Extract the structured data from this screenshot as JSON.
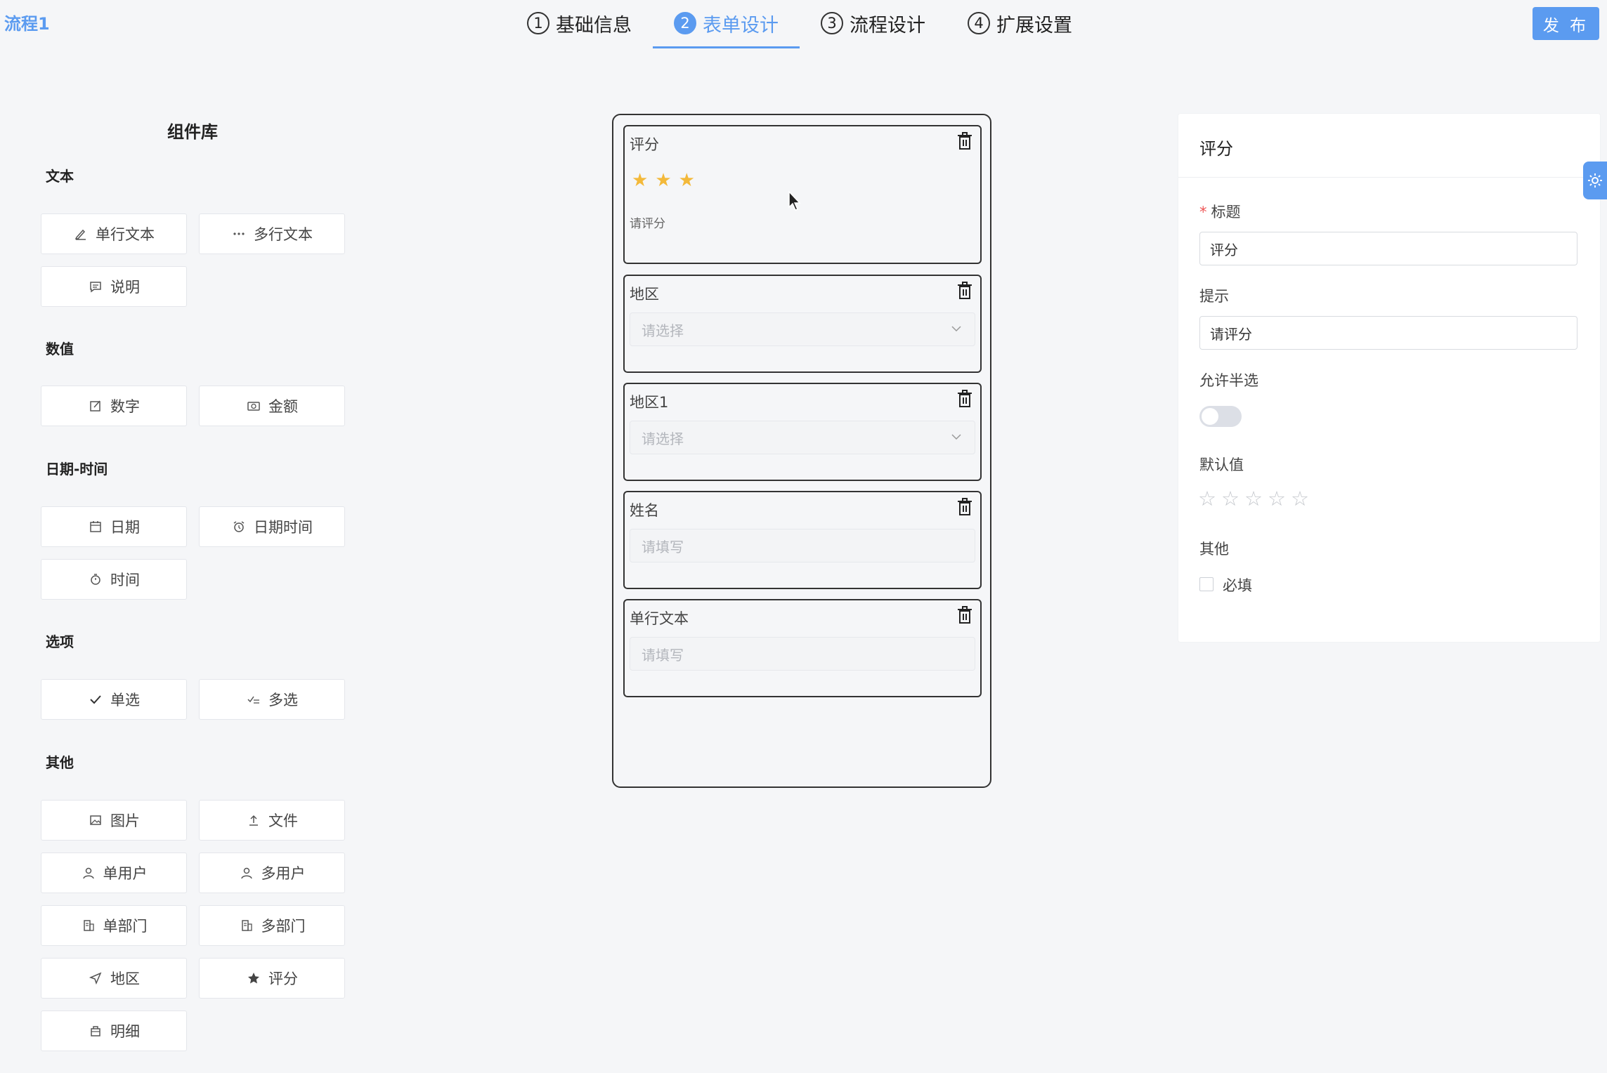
{
  "header": {
    "app_title": "流程1",
    "steps": [
      {
        "num": "1",
        "label": "基础信息"
      },
      {
        "num": "2",
        "label": "表单设计"
      },
      {
        "num": "3",
        "label": "流程设计"
      },
      {
        "num": "4",
        "label": "扩展设置"
      }
    ],
    "active_step": 2,
    "publish_label": "发 布"
  },
  "library": {
    "title": "组件库",
    "sections": [
      {
        "label": "文本",
        "items": [
          {
            "label": "单行文本",
            "icon": "pencil-icon"
          },
          {
            "label": "多行文本",
            "icon": "ellipsis-icon"
          },
          {
            "label": "说明",
            "icon": "comment-icon"
          }
        ]
      },
      {
        "label": "数值",
        "items": [
          {
            "label": "数字",
            "icon": "edit-icon"
          },
          {
            "label": "金额",
            "icon": "money-icon"
          }
        ]
      },
      {
        "label": "日期-时间",
        "items": [
          {
            "label": "日期",
            "icon": "calendar-icon"
          },
          {
            "label": "日期时间",
            "icon": "alarm-clock-icon"
          },
          {
            "label": "时间",
            "icon": "stopwatch-icon"
          }
        ]
      },
      {
        "label": "选项",
        "items": [
          {
            "label": "单选",
            "icon": "check-icon"
          },
          {
            "label": "多选",
            "icon": "check-list-icon"
          }
        ]
      },
      {
        "label": "其他",
        "items": [
          {
            "label": "图片",
            "icon": "picture-icon"
          },
          {
            "label": "文件",
            "icon": "upload-icon"
          },
          {
            "label": "单用户",
            "icon": "user-icon"
          },
          {
            "label": "多用户",
            "icon": "users-icon"
          },
          {
            "label": "单部门",
            "icon": "building-icon"
          },
          {
            "label": "多部门",
            "icon": "buildings-icon"
          },
          {
            "label": "地区",
            "icon": "location-arrow-icon"
          },
          {
            "label": "评分",
            "icon": "star-icon"
          },
          {
            "label": "明细",
            "icon": "bag-icon"
          }
        ]
      }
    ]
  },
  "canvas": {
    "fields": [
      {
        "label": "评分",
        "type": "rate",
        "value": 3,
        "max": 5,
        "hint": "请评分"
      },
      {
        "label": "地区",
        "type": "select",
        "placeholder": "请选择"
      },
      {
        "label": "地区1",
        "type": "select",
        "placeholder": "请选择"
      },
      {
        "label": "姓名",
        "type": "input",
        "placeholder": "请填写"
      },
      {
        "label": "单行文本",
        "type": "input",
        "placeholder": "请填写"
      }
    ]
  },
  "panel": {
    "title": "评分",
    "title_field_label": "标题",
    "title_field_value": "评分",
    "hint_label": "提示",
    "hint_value": "请评分",
    "half_label": "允许半选",
    "half_enabled": false,
    "default_label": "默认值",
    "default_value": 0,
    "other_label": "其他",
    "required_label": "必填",
    "required_checked": false
  },
  "colors": {
    "accent": "#5b9bf0",
    "star": "#f3b93a",
    "required": "#e55555"
  }
}
